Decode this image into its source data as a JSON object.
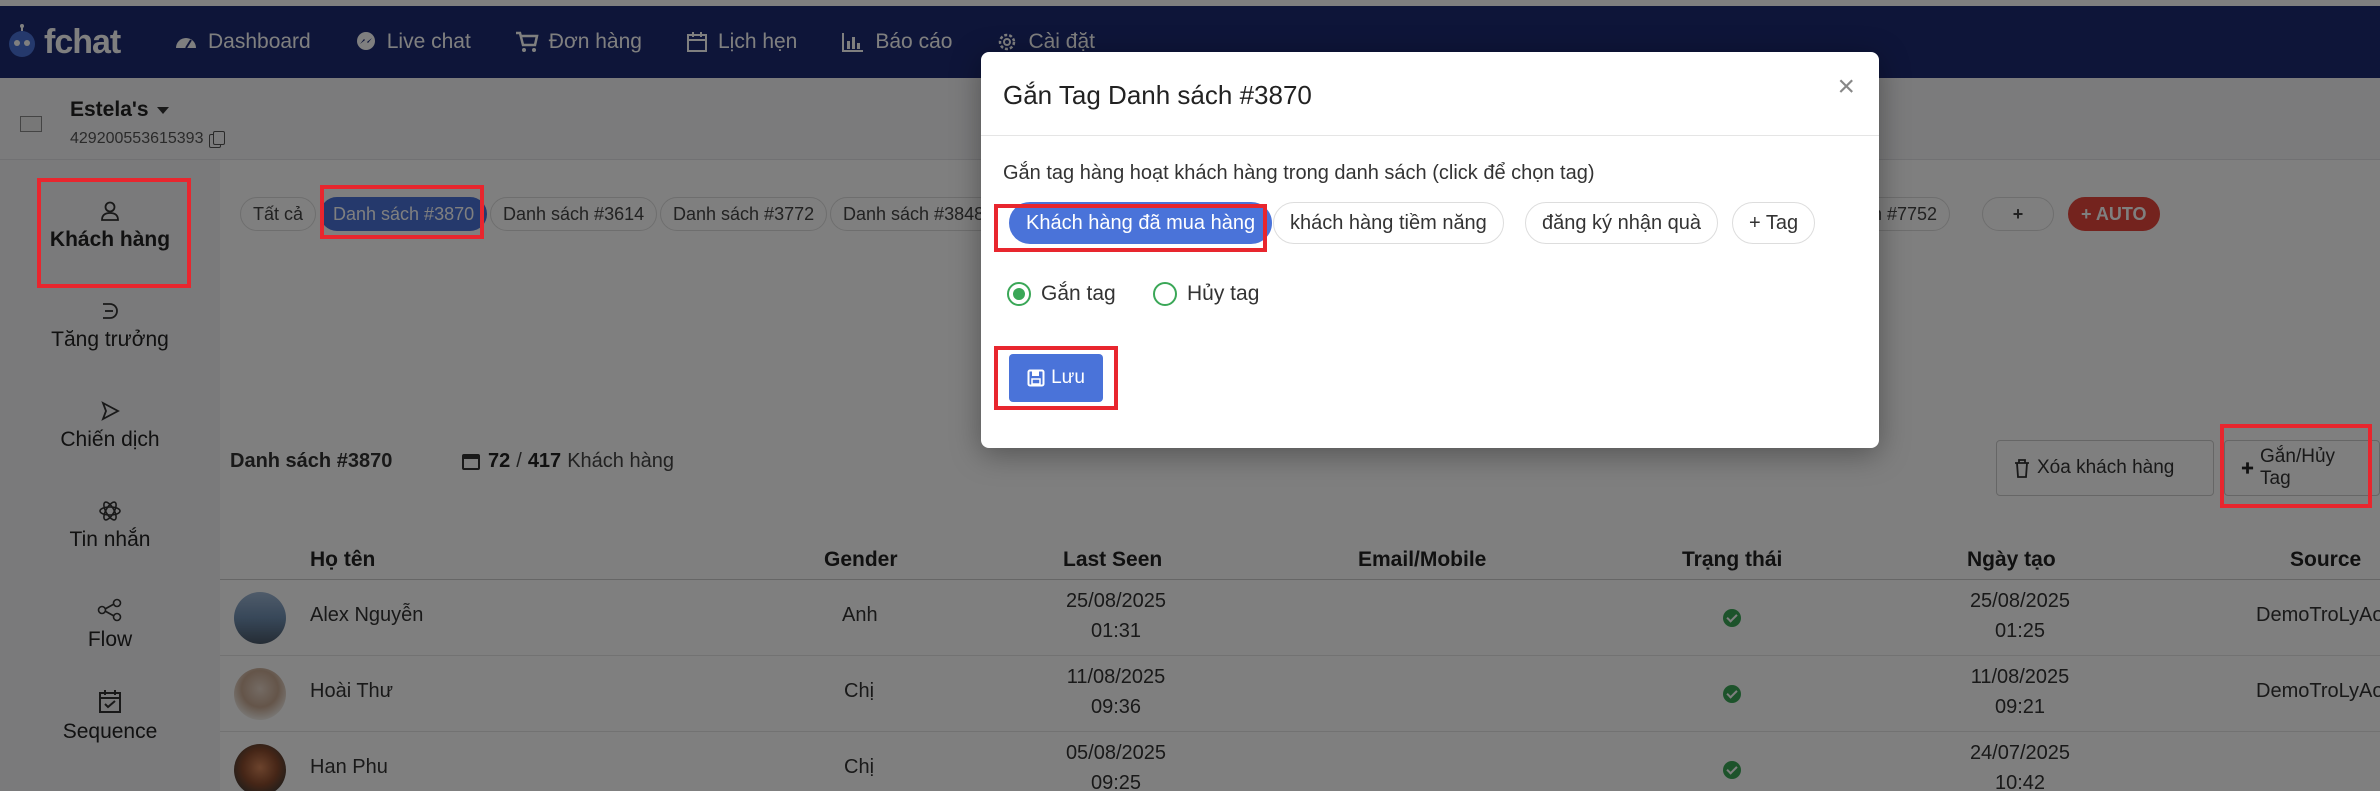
{
  "brand": {
    "name": "fchat"
  },
  "nav": [
    {
      "label": "Dashboard",
      "icon": "dashboard-icon"
    },
    {
      "label": "Live chat",
      "icon": "messenger-icon"
    },
    {
      "label": "Đơn hàng",
      "icon": "cart-icon"
    },
    {
      "label": "Lịch hẹn",
      "icon": "calendar-icon"
    },
    {
      "label": "Báo cáo",
      "icon": "bar-chart-icon"
    },
    {
      "label": "Cài đặt",
      "icon": "gear-icon"
    }
  ],
  "page": {
    "name": "Estela's",
    "id": "429200553615393"
  },
  "sidebar": [
    {
      "label": "Khách hàng",
      "icon": "user-icon"
    },
    {
      "label": "Tăng trưởng",
      "icon": "growth-icon"
    },
    {
      "label": "Chiến dịch",
      "icon": "send-icon"
    },
    {
      "label": "Tin nhắn",
      "icon": "atom-icon"
    },
    {
      "label": "Flow",
      "icon": "flow-icon"
    },
    {
      "label": "Sequence",
      "icon": "calendar-check-icon"
    }
  ],
  "list_tabs": [
    "Tất cả",
    "Danh sách #3870",
    "Danh sách #3614",
    "Danh sách #3772",
    "Danh sách #3848",
    "ch #7752",
    "+",
    "+ AUTO"
  ],
  "list": {
    "title": "Danh sách #3870",
    "count_shown": "72",
    "count_sep": "/",
    "count_total": "417",
    "count_unit": "Khách hàng"
  },
  "actions": {
    "delete_label": "Xóa khách hàng",
    "tag_label": "Gắn/Hủy Tag"
  },
  "table": {
    "columns": [
      "Họ tên",
      "Gender",
      "Last Seen",
      "Email/Mobile",
      "Trạng thái",
      "Ngày tạo",
      "Source"
    ],
    "rows": [
      {
        "name": "Alex Nguyễn",
        "gender": "Anh",
        "last_seen_date": "25/08/2025",
        "last_seen_time": "01:31",
        "email": "",
        "created_date": "25/08/2025",
        "created_time": "01:25",
        "source": "DemoTroLyAo"
      },
      {
        "name": "Hoài Thư",
        "gender": "Chị",
        "last_seen_date": "11/08/2025",
        "last_seen_time": "09:36",
        "email": "",
        "created_date": "11/08/2025",
        "created_time": "09:21",
        "source": "DemoTroLyAo"
      },
      {
        "name": "Han Phu",
        "gender": "Chị",
        "last_seen_date": "05/08/2025",
        "last_seen_time": "09:25",
        "email": "",
        "created_date": "24/07/2025",
        "created_time": "10:42",
        "source": ""
      }
    ]
  },
  "modal": {
    "title": "Gắn Tag Danh sách #3870",
    "close": "×",
    "description": "Gắn tag hàng hoạt khách hàng trong danh sách (click để chọn tag)",
    "tags": [
      "Khách hàng đã mua hàng",
      "khách hàng tiềm năng",
      "đăng ký nhận quà",
      "+ Tag"
    ],
    "radio_assign": "Gắn tag",
    "radio_remove": "Hủy tag",
    "save_label": "Lưu"
  },
  "colors": {
    "navbar": "#1c2a72",
    "accent": "#4a73d9",
    "highlight": "#e8262e",
    "success": "#3aa757",
    "danger": "#e9473c"
  }
}
